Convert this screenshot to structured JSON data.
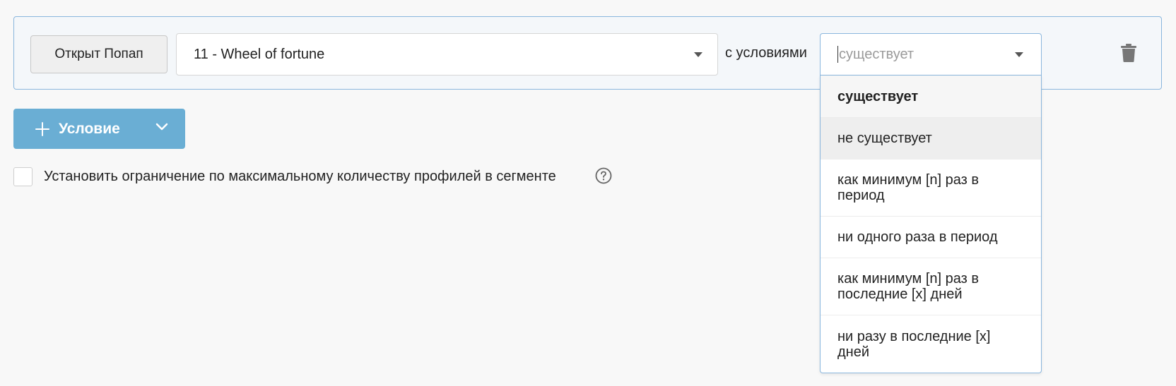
{
  "condition": {
    "event_type_button": "Открыт Попап",
    "popup_select": {
      "value": "11 - Wheel of fortune"
    },
    "with_conditions_label": "с условиями",
    "operator_select": {
      "placeholder": "существует",
      "options": [
        "существует",
        "не существует",
        "как минимум [n] раз в период",
        "ни одного раза в период",
        "как минимум [n] раз в последние [x] дней",
        "ни разу в последние [x] дней"
      ],
      "selected_option": "существует",
      "hovered_option": "не существует"
    },
    "delete_icon": "trash-icon"
  },
  "add_condition_button": {
    "label": "Условие",
    "plus_icon": "plus-icon",
    "chevron_icon": "chevron-down-icon"
  },
  "limit_option": {
    "checked": false,
    "label": "Установить ограничение по максимальному количеству профилей в сегменте",
    "help_icon": "question-circle-icon"
  },
  "colors": {
    "accent": "#6aaed4",
    "border_focus": "#8ab6dd",
    "background": "#f8f8f8"
  }
}
